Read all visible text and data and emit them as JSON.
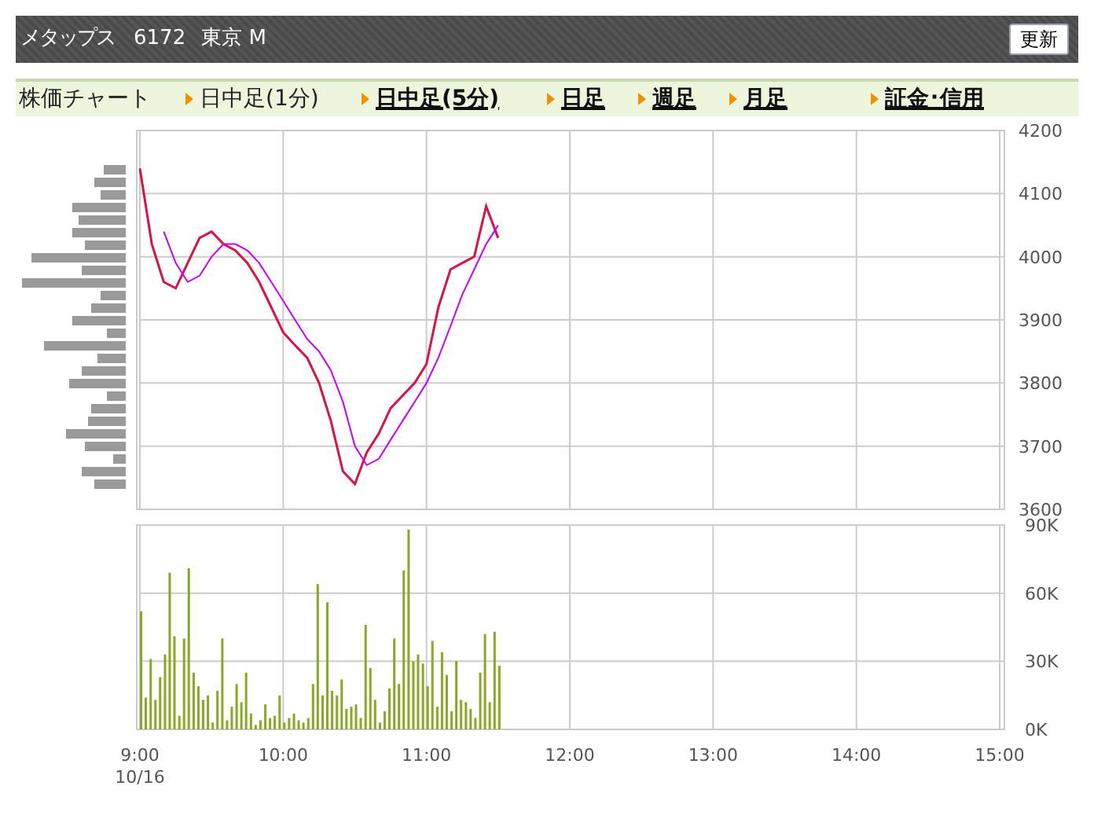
{
  "header": {
    "name": "メタップス",
    "code": "6172",
    "market": "東京 M",
    "refresh_button": "更新"
  },
  "nav": [
    {
      "label": "株価チャート",
      "kind": "label"
    },
    {
      "label": "日中足(1分)",
      "kind": "link",
      "selected": true
    },
    {
      "label": "日中足(5分)",
      "kind": "link",
      "selected": false
    },
    {
      "label": "日足",
      "kind": "link",
      "selected": false
    },
    {
      "label": "週足",
      "kind": "link",
      "selected": false
    },
    {
      "label": "月足",
      "kind": "link",
      "selected": false
    },
    {
      "label": "証金･信用",
      "kind": "link",
      "selected": false
    }
  ],
  "price_chart": {
    "chart_data": {
      "type": "line",
      "grid": true,
      "x": [
        9,
        9.083,
        9.167,
        9.25,
        9.333,
        9.417,
        9.5,
        9.583,
        9.667,
        9.75,
        9.833,
        9.917,
        10,
        10.083,
        10.167,
        10.25,
        10.333,
        10.417,
        10.5,
        10.583,
        10.667,
        10.75,
        10.833,
        10.917,
        11,
        11.083,
        11.167,
        11.25,
        11.333,
        11.417,
        11.5
      ],
      "series": [
        {
          "color": "#dd1144",
          "values": [
            4140,
            4020,
            3960,
            3950,
            3990,
            4030,
            4040,
            4020,
            4010,
            3990,
            3960,
            3920,
            3880,
            3860,
            3840,
            3800,
            3740,
            3660,
            3640,
            3690,
            3720,
            3760,
            3780,
            3800,
            3830,
            3920,
            3980,
            3990,
            4000,
            4080,
            4030
          ]
        },
        {
          "color": "#cc00ff",
          "values": [
            null,
            null,
            4040,
            3990,
            3960,
            3970,
            4000,
            4020,
            4020,
            4010,
            3990,
            3960,
            3930,
            3900,
            3870,
            3850,
            3820,
            3770,
            3700,
            3670,
            3680,
            3710,
            3740,
            3770,
            3800,
            3840,
            3890,
            3940,
            3980,
            4020,
            4050
          ]
        }
      ],
      "xlim": [
        9,
        15
      ],
      "ylim": [
        3600,
        4200
      ],
      "yticks": [
        3600,
        3700,
        3800,
        3900,
        4000,
        4100,
        4200
      ]
    }
  },
  "volume_chart": {
    "chart_data": {
      "type": "bar",
      "grid": true,
      "x": [
        9,
        9.033,
        9.067,
        9.1,
        9.133,
        9.167,
        9.2,
        9.233,
        9.267,
        9.3,
        9.333,
        9.367,
        9.4,
        9.433,
        9.467,
        9.5,
        9.533,
        9.567,
        9.6,
        9.633,
        9.667,
        9.7,
        9.733,
        9.767,
        9.8,
        9.833,
        9.867,
        9.9,
        9.933,
        9.967,
        10,
        10.033,
        10.067,
        10.1,
        10.133,
        10.167,
        10.2,
        10.233,
        10.267,
        10.3,
        10.333,
        10.367,
        10.4,
        10.433,
        10.467,
        10.5,
        10.533,
        10.567,
        10.6,
        10.633,
        10.667,
        10.7,
        10.733,
        10.767,
        10.8,
        10.833,
        10.867,
        10.9,
        10.933,
        10.967,
        11,
        11.033,
        11.067,
        11.1,
        11.133,
        11.167,
        11.2,
        11.233,
        11.267,
        11.3,
        11.333,
        11.367,
        11.4,
        11.433,
        11.467,
        11.5
      ],
      "values": [
        52000,
        14000,
        31000,
        13000,
        23000,
        33000,
        69000,
        41000,
        6000,
        40000,
        71000,
        25000,
        19000,
        13000,
        15000,
        3000,
        17000,
        40000,
        4000,
        10000,
        20000,
        12000,
        25000,
        7000,
        2000,
        4000,
        11000,
        5000,
        6000,
        15000,
        3000,
        5000,
        7000,
        4000,
        3000,
        5000,
        20000,
        64000,
        15000,
        56000,
        17000,
        15000,
        22000,
        9000,
        10000,
        11000,
        5000,
        46000,
        27000,
        13000,
        3000,
        8000,
        18000,
        40000,
        20000,
        70000,
        88000,
        30000,
        33000,
        29000,
        19000,
        39000,
        10000,
        34000,
        24000,
        8000,
        30000,
        13000,
        12000,
        9000,
        5000,
        25000,
        42000,
        12000,
        43000,
        28000
      ],
      "color": "#88aa22",
      "xlim": [
        9,
        15
      ],
      "ylim": [
        0,
        90000
      ],
      "yticks": [
        {
          "value": 0,
          "label": "0K"
        },
        {
          "value": 30000,
          "label": "30K"
        },
        {
          "value": 60000,
          "label": "60K"
        },
        {
          "value": 90000,
          "label": "90K"
        }
      ],
      "xticks": [
        {
          "value": 9,
          "label": "9:00"
        },
        {
          "value": 10,
          "label": "10:00"
        },
        {
          "value": 11,
          "label": "11:00"
        },
        {
          "value": 12,
          "label": "12:00"
        },
        {
          "value": 13,
          "label": "13:00"
        },
        {
          "value": 14,
          "label": "14:00"
        },
        {
          "value": 15,
          "label": "15:00"
        }
      ]
    },
    "date_label": "10/16"
  }
}
